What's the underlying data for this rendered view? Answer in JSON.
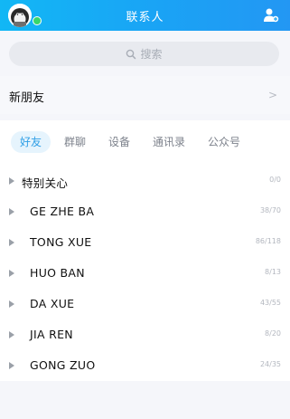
{
  "header": {
    "title": "联系人",
    "avatar_icon": "avatar-icon",
    "add_contact_icon": "add-contact-icon",
    "online_color": "#38d66b",
    "bg_color": "#12b7f5"
  },
  "search": {
    "placeholder": "搜索",
    "icon": "search-icon"
  },
  "new_friends": {
    "label": "新朋友",
    "chevron": ">"
  },
  "tabs": [
    {
      "label": "好友",
      "active": true
    },
    {
      "label": "群聊",
      "active": false
    },
    {
      "label": "设备",
      "active": false
    },
    {
      "label": "通讯录",
      "active": false
    },
    {
      "label": "公众号",
      "active": false
    }
  ],
  "groups": [
    {
      "name": "特别关心",
      "count": "0/0"
    },
    {
      "name": "GE ZHE BA",
      "count": "38/70"
    },
    {
      "name": "TONG  XUE",
      "count": "86/118"
    },
    {
      "name": "HUO  BAN",
      "count": "8/13"
    },
    {
      "name": "DA  XUE",
      "count": "43/55"
    },
    {
      "name": "JIA  REN",
      "count": "8/20"
    },
    {
      "name": "GONG  ZUO",
      "count": "24/35"
    }
  ]
}
